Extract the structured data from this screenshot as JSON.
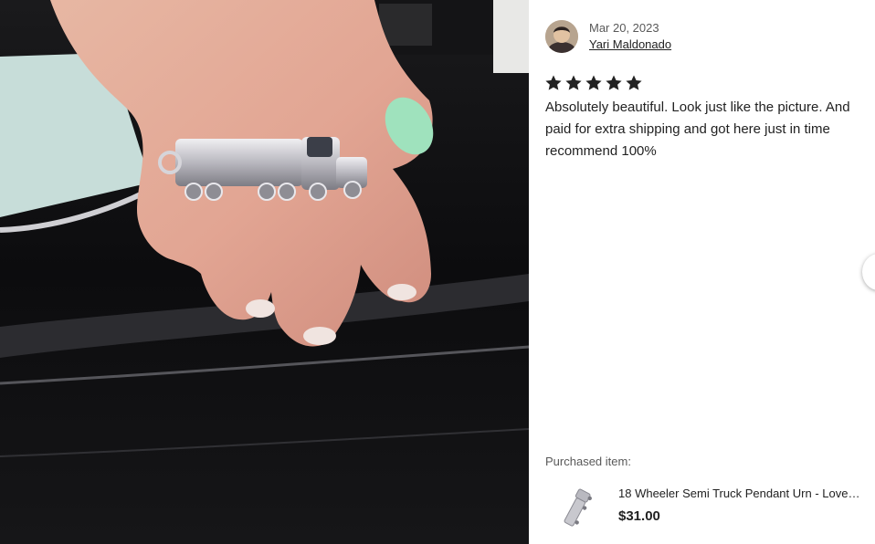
{
  "review": {
    "date": "Mar 20, 2023",
    "reviewer_name": "Yari Maldonado",
    "rating": 5,
    "rating_max": 5,
    "text": "Absolutely beautiful. Look just like the picture. And paid for extra shipping and got here just in time recommend 100%"
  },
  "purchased": {
    "label": "Purchased item:",
    "title": "18 Wheeler Semi Truck Pendant Urn - Love…",
    "price": "$31.00"
  },
  "colors": {
    "star": "#222222",
    "text_primary": "#222222",
    "text_secondary": "#595959",
    "panel_background": "#ffffff"
  },
  "icons": {
    "star": "star-icon",
    "avatar": "avatar",
    "thumbnail": "truck-pendant-thumbnail"
  }
}
